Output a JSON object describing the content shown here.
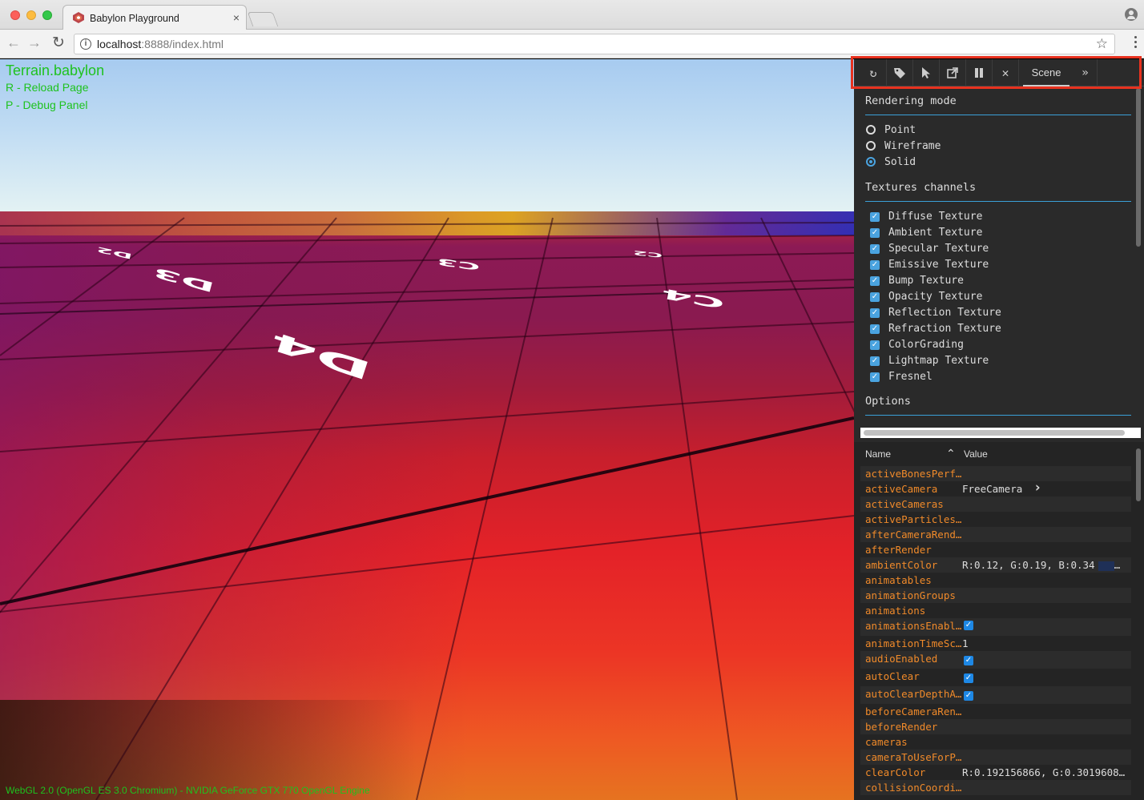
{
  "browser": {
    "tab_title": "Babylon Playground",
    "tab_close": "×",
    "url_host": "localhost",
    "url_path": ":8888/index.html",
    "info_glyph": "i",
    "star_glyph": "☆",
    "back_glyph": "←",
    "forward_glyph": "→",
    "reload_glyph": "↻"
  },
  "viewport": {
    "title": "Terrain.babylon",
    "hint_reload": "R - Reload Page",
    "hint_debug": "P - Debug Panel",
    "engine_info": "WebGL 2.0 (OpenGL ES 3.0 Chromium) - NVIDIA GeForce GTX 770 OpenGL Engine",
    "tile_labels": [
      "D4",
      "C4",
      "D3",
      "C3",
      "D2",
      "C2"
    ]
  },
  "debug_panel": {
    "toolbar": {
      "refresh_icon": "↻",
      "tags_icon": "🏷",
      "pick_icon": "➤",
      "popout_icon": "↗",
      "pause_icon": "❚❚",
      "close_icon": "✕",
      "active_tab": "Scene",
      "more": "»"
    },
    "rendering_mode": {
      "title": "Rendering mode",
      "options": [
        "Point",
        "Wireframe",
        "Solid"
      ],
      "selected": "Solid"
    },
    "textures": {
      "title": "Textures channels",
      "channels": [
        "Diffuse Texture",
        "Ambient Texture",
        "Specular Texture",
        "Emissive Texture",
        "Bump Texture",
        "Opacity Texture",
        "Reflection Texture",
        "Refraction Texture",
        "ColorGrading",
        "Lightmap Texture",
        "Fresnel"
      ]
    },
    "options_title": "Options",
    "properties": {
      "col_name": "Name",
      "col_value": "Value",
      "rows": [
        {
          "name": "activeBonesPerf…",
          "value": ""
        },
        {
          "name": "activeCamera",
          "value": "FreeCamera"
        },
        {
          "name": "activeCameras",
          "value": ""
        },
        {
          "name": "activeParticles…",
          "value": ""
        },
        {
          "name": "afterCameraRend…",
          "value": ""
        },
        {
          "name": "afterRender",
          "value": ""
        },
        {
          "name": "ambientColor",
          "value": "R:0.12, G:0.19, B:0.34"
        },
        {
          "name": "animatables",
          "value": ""
        },
        {
          "name": "animationGroups",
          "value": ""
        },
        {
          "name": "animations",
          "value": ""
        },
        {
          "name": "animationsEnabl…",
          "value": ""
        },
        {
          "name": "animationTimeSc…",
          "value": "1"
        },
        {
          "name": "audioEnabled",
          "value": ""
        },
        {
          "name": "autoClear",
          "value": ""
        },
        {
          "name": "autoClearDepthA…",
          "value": ""
        },
        {
          "name": "beforeCameraRen…",
          "value": ""
        },
        {
          "name": "beforeRender",
          "value": ""
        },
        {
          "name": "cameras",
          "value": ""
        },
        {
          "name": "cameraToUseForP…",
          "value": ""
        },
        {
          "name": "clearColor",
          "value": "R:0.192156866, G:0.3019608…"
        },
        {
          "name": "collisionCoordi…",
          "value": ""
        }
      ],
      "ambient_ellipsis": "…",
      "expand_arrow": "›"
    }
  }
}
